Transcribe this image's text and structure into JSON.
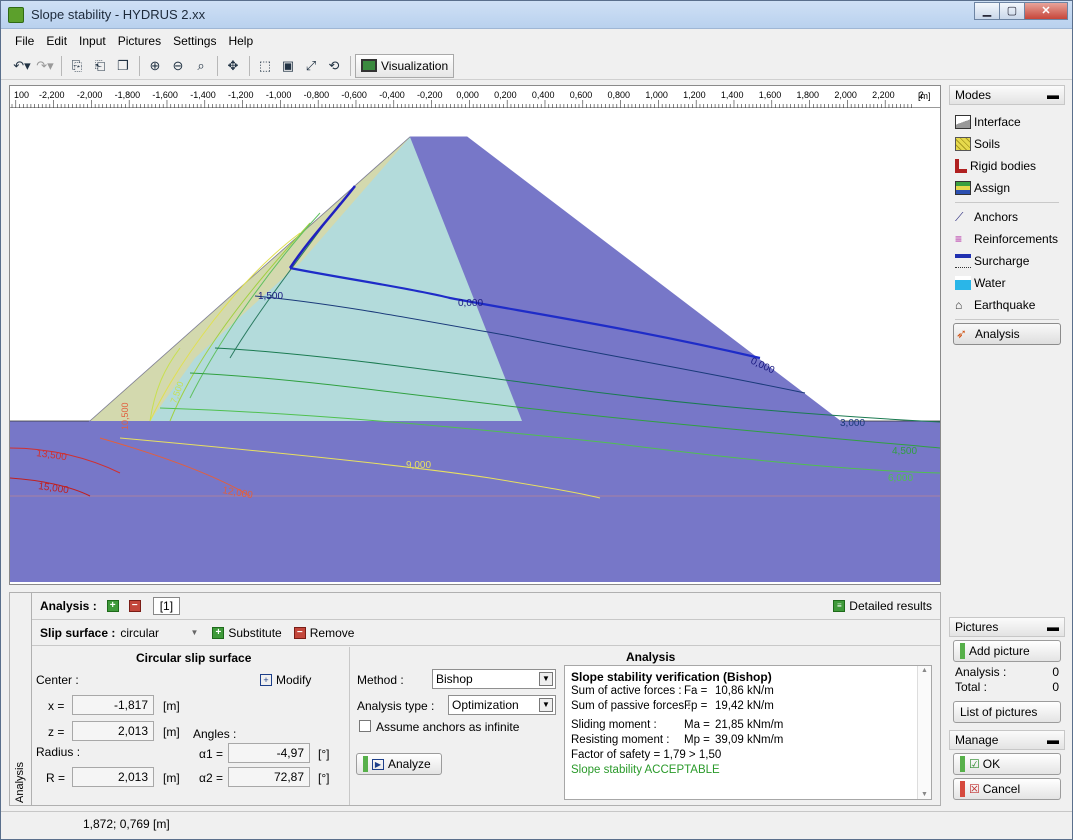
{
  "window": {
    "title": "Slope stability - HYDRUS 2.xx"
  },
  "menu": {
    "file": "File",
    "edit": "Edit",
    "input": "Input",
    "pictures": "Pictures",
    "settings": "Settings",
    "help": "Help"
  },
  "toolbar": {
    "visualization": "Visualization"
  },
  "ruler": {
    "unit": "[m]",
    "ticks": [
      "100",
      "-2,200",
      "-2,000",
      "-1,800",
      "-1,600",
      "-1,400",
      "-1,200",
      "-1,000",
      "-0,800",
      "-0,600",
      "-0,400",
      "-0,200",
      "0,000",
      "0,200",
      "0,400",
      "0,600",
      "0,800",
      "1,000",
      "1,200",
      "1,400",
      "1,600",
      "1,800",
      "2,000",
      "2,200",
      "2"
    ]
  },
  "contours": {
    "l1": "1,500",
    "l2": "0,000",
    "l3": "0,000",
    "l4": "3,000",
    "l5": "4,500",
    "l6": "6,000",
    "l7": "9,000",
    "l8": "12,000",
    "l9": "13,500",
    "l10": "15,000",
    "l11": "10,500",
    "l12": "7,500"
  },
  "colors": {
    "dam_core": "#b3dbdb",
    "dam_shell": "#7777c8",
    "foundation": "#7777c8",
    "slope_zone": "#d6d8a8"
  },
  "modes": {
    "header": "Modes",
    "items": [
      "Interface",
      "Soils",
      "Rigid bodies",
      "Assign",
      "Anchors",
      "Reinforcements",
      "Surcharge",
      "Water",
      "Earthquake",
      "Analysis"
    ]
  },
  "pictures": {
    "header": "Pictures",
    "add": "Add picture",
    "analysis_label": "Analysis :",
    "analysis_count": "0",
    "total_label": "Total :",
    "total_count": "0",
    "list": "List of pictures"
  },
  "manage": {
    "header": "Manage",
    "ok": "OK",
    "cancel": "Cancel"
  },
  "bottom": {
    "tab": "Analysis",
    "analysis_label": "Analysis :",
    "analysis_index": "[1]",
    "detailed_results": "Detailed results",
    "slip_surface_label": "Slip surface :",
    "slip_surface_value": "circular",
    "substitute": "Substitute",
    "remove": "Remove",
    "circ_title": "Circular slip surface",
    "center": "Center :",
    "modify": "Modify",
    "x_label": "x =",
    "x_value": "-1,817",
    "x_unit": "[m]",
    "z_label": "z =",
    "z_value": "2,013",
    "z_unit": "[m]",
    "angles": "Angles :",
    "radius": "Radius :",
    "r_label": "R =",
    "r_value": "2,013",
    "r_unit": "[m]",
    "a1_label": "α1 =",
    "a1_value": "-4,97",
    "a1_unit": "[°]",
    "a2_label": "α2 =",
    "a2_value": "72,87",
    "a2_unit": "[°]",
    "method_label": "Method :",
    "method_value": "Bishop",
    "analysis_type_label": "Analysis type :",
    "analysis_type_value": "Optimization",
    "anchors_infinite": "Assume anchors as infinite",
    "analyze": "Analyze",
    "analysis_title": "Analysis"
  },
  "results": {
    "title": "Slope stability verification (Bishop)",
    "active_label": "Sum of active forces :",
    "active_sym": "Fa =",
    "active_val": "10,86 kN/m",
    "passive_label": "Sum of passive forces :",
    "passive_sym": "Fp =",
    "passive_val": "19,42 kN/m",
    "sliding_label": "Sliding moment :",
    "sliding_sym": "Ma =",
    "sliding_val": "21,85 kNm/m",
    "resisting_label": "Resisting moment :",
    "resisting_sym": "Mp =",
    "resisting_val": "39,09 kNm/m",
    "fos": "Factor of safety = 1,79 > 1,50",
    "verdict": "Slope stability ACCEPTABLE"
  },
  "status": {
    "coords": "1,872; 0,769 [m]"
  }
}
